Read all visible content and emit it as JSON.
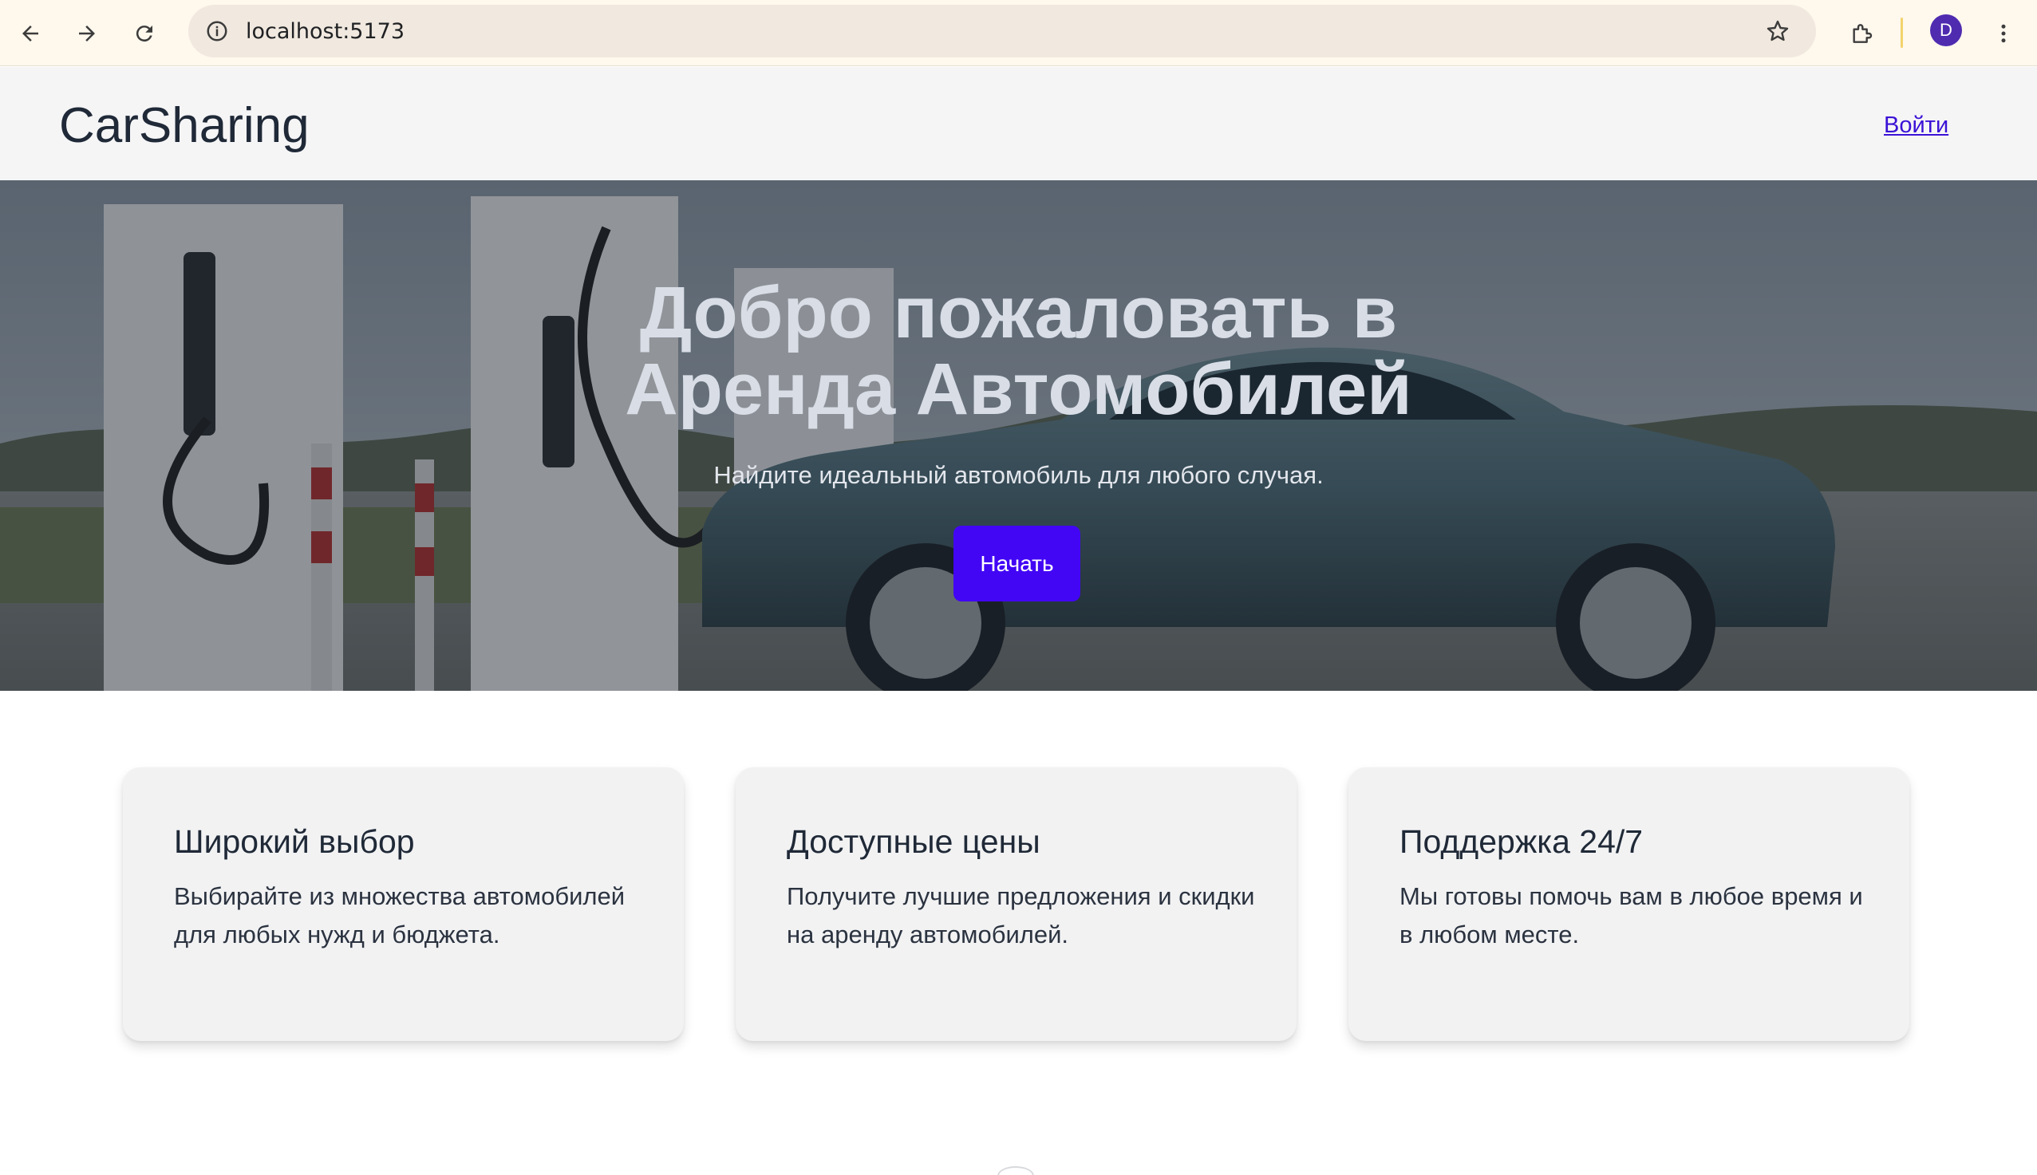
{
  "browser": {
    "url": "localhost:5173",
    "profile_initial": "D",
    "icons": [
      "back-arrow-icon",
      "forward-arrow-icon",
      "reload-icon",
      "site-info-icon",
      "bookmark-star-icon",
      "extensions-icon",
      "more-menu-icon"
    ]
  },
  "header": {
    "brand": "CarSharing",
    "login_label": "Войти"
  },
  "hero": {
    "title_line1": "Добро пожаловать в",
    "title_line2": "Аренда Автомобилей",
    "subtitle": "Найдите идеальный автомобиль для любого случая.",
    "cta_label": "Начать",
    "cta_color": "#4206f5"
  },
  "features": [
    {
      "title": "Широкий выбор",
      "text": "Выбирайте из множества автомобилей для любых нужд и бюджета."
    },
    {
      "title": "Доступные цены",
      "text": "Получите лучшие предложения и скидки на аренду автомобилей."
    },
    {
      "title": "Поддержка 24/7",
      "text": "Мы готовы помочь вам в любое время и в любом месте."
    }
  ],
  "colors": {
    "link": "#3b12d6",
    "header_bg": "#f5f5f6",
    "card_bg": "#f2f2f3"
  }
}
